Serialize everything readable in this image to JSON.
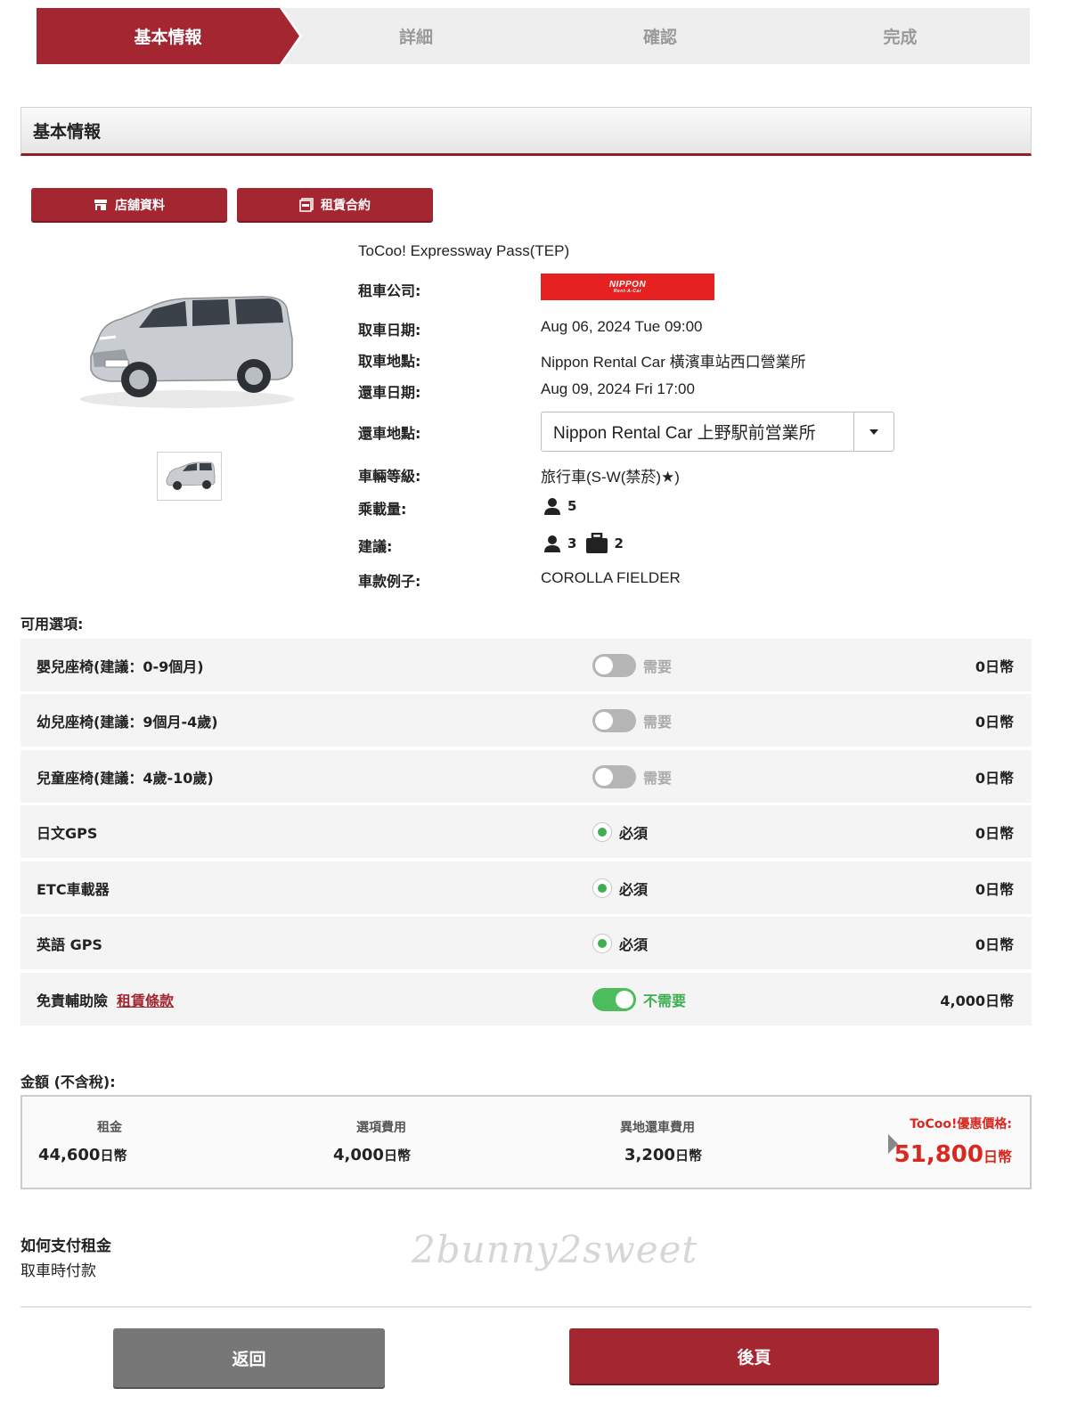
{
  "steps": [
    "基本情報",
    "詳細",
    "確認",
    "完成"
  ],
  "section_title": "基本情報",
  "buttons": {
    "store_info": "店舖資料",
    "rental_contract": "租賃合約"
  },
  "plan_name": "ToCoo! Expressway Pass(TEP)",
  "company_logo": {
    "text": "NIPPON",
    "sub": "Rent-A-Car",
    "color": "#e52121"
  },
  "details": {
    "rental_company_label": "租車公司:",
    "pickup_date_label": "取車日期:",
    "pickup_date": "Aug 06, 2024 Tue 09:00",
    "pickup_location_label": "取車地點:",
    "pickup_location": "Nippon Rental Car 橫濱車站西口營業所",
    "return_date_label": "還車日期:",
    "return_date": "Aug 09, 2024 Fri 17:00",
    "return_location_label": "還車地點:",
    "return_location": "Nippon Rental Car 上野駅前営業所",
    "car_class_label": "車輛等級:",
    "car_class": "旅行車(S-W(禁菸)★)",
    "capacity_label": "乘載量:",
    "capacity": "5",
    "recommended_label": "建議:",
    "recommended_people": "3",
    "recommended_luggage": "2",
    "model_label": "車款例子:",
    "model": "COROLLA FIELDER"
  },
  "options_title": "可用選項:",
  "options": [
    {
      "name": "嬰兒座椅(建議：0-9個月)",
      "control": "toggle",
      "on": false,
      "label": "需要",
      "price": "0日幣"
    },
    {
      "name": "幼兒座椅(建議：9個月-4歲)",
      "control": "toggle",
      "on": false,
      "label": "需要",
      "price": "0日幣"
    },
    {
      "name": "兒童座椅(建議：4歲-10歲)",
      "control": "toggle",
      "on": false,
      "label": "需要",
      "price": "0日幣"
    },
    {
      "name": "日文GPS",
      "control": "radio",
      "label": "必須",
      "price": "0日幣"
    },
    {
      "name": "ETC車載器",
      "control": "radio",
      "label": "必須",
      "price": "0日幣"
    },
    {
      "name": "英語 GPS",
      "control": "radio",
      "label": "必須",
      "price": "0日幣"
    },
    {
      "name": "免責輔助險",
      "link": "租賃條款",
      "control": "toggle",
      "on": true,
      "label": "不需要",
      "price": "4,000日幣"
    }
  ],
  "amount": {
    "title": "金額 (不含稅):",
    "rent_label": "租金",
    "rent_value": "44,600",
    "option_label": "選項費用",
    "option_value": "4,000",
    "oneway_label": "異地還車費用",
    "oneway_value": "3,200",
    "currency": "日幣",
    "deal_label": "ToCoo!優惠價格:",
    "deal_value": "51,800"
  },
  "payment": {
    "title": "如何支付租金",
    "value": "取車時付款"
  },
  "watermark": "2bunny2sweet",
  "nav": {
    "back": "返回",
    "next": "後頁"
  },
  "colors": {
    "brand": "#a32631",
    "deal": "#d8281f",
    "toggle_on": "#4cbc5c"
  }
}
